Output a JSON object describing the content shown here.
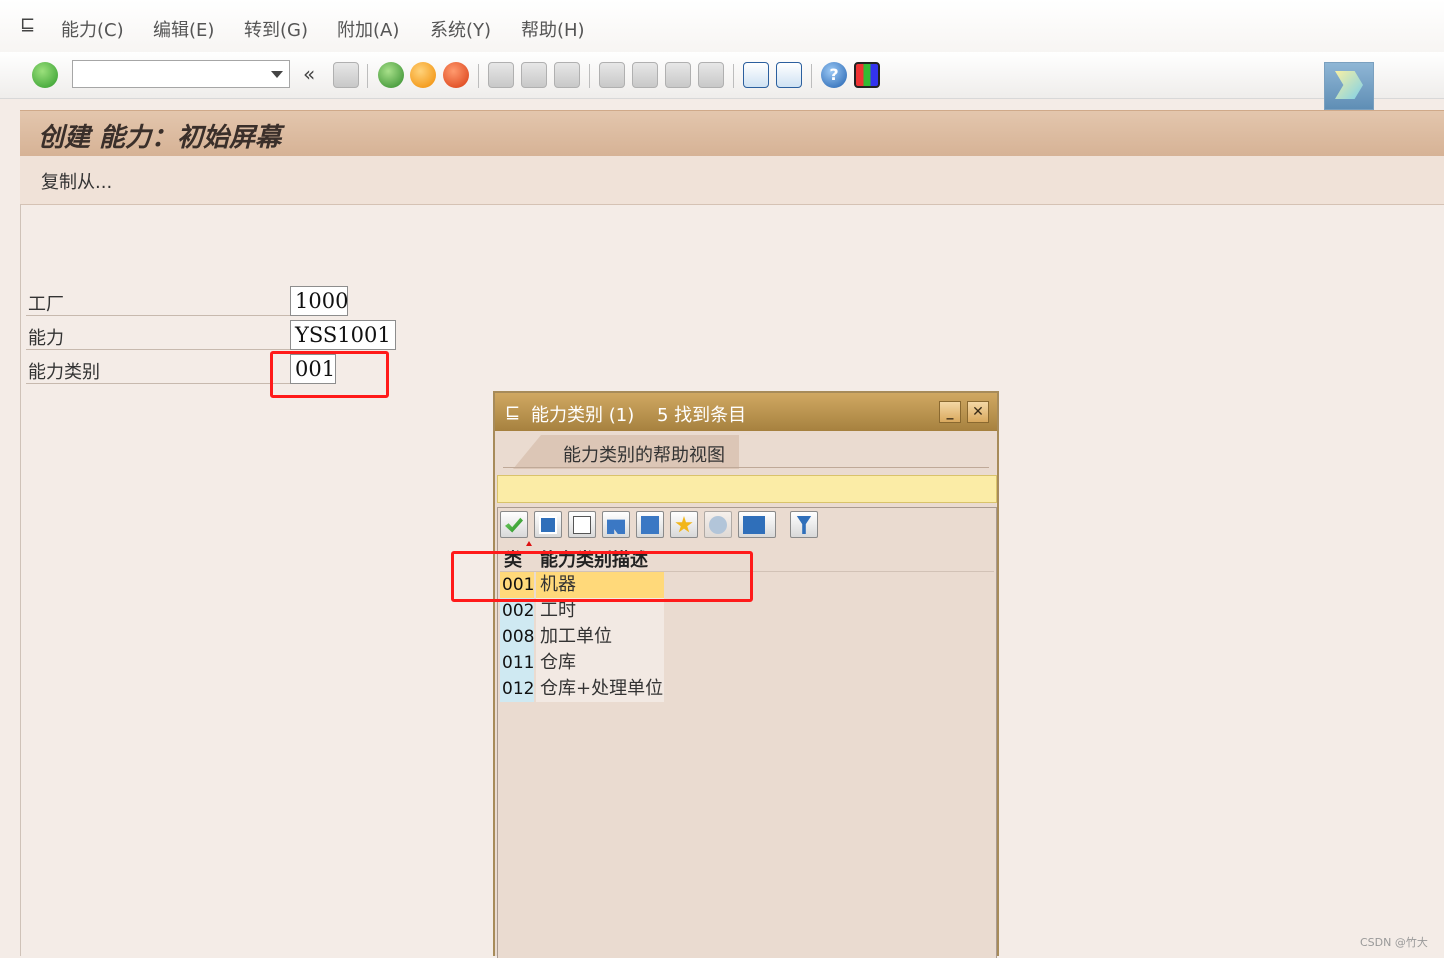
{
  "menubar": {
    "items": [
      {
        "label": "能力(C)"
      },
      {
        "label": "编辑(E)"
      },
      {
        "label": "转到(G)"
      },
      {
        "label": "附加(A)"
      },
      {
        "label": "系统(Y)"
      },
      {
        "label": "帮助(H)"
      }
    ]
  },
  "toolbar": {
    "command_field_value": "",
    "collapse_glyph": "«"
  },
  "header": {
    "title": "创建 能力：初始屏幕",
    "copy_from": "复制从..."
  },
  "form": {
    "plant_label": "工厂",
    "plant_value": "1000",
    "capacity_label": "能力",
    "capacity_value": "YSS1001",
    "category_label": "能力类别",
    "category_value": "001"
  },
  "popup": {
    "title": "能力类别 (1)",
    "count_text": "5 找到条目",
    "tab_label": "能力类别的帮助视图",
    "minimize_glyph": "_",
    "close_glyph": "✕",
    "columns": [
      "类",
      "能力类别描述"
    ],
    "rows": [
      {
        "code": "001",
        "desc": "机器"
      },
      {
        "code": "002",
        "desc": "工时"
      },
      {
        "code": "008",
        "desc": "加工单位"
      },
      {
        "code": "011",
        "desc": "仓库"
      },
      {
        "code": "012",
        "desc": "仓库+处理单位"
      }
    ],
    "selected_row": "001"
  },
  "watermark": "CSDN @竹大",
  "colors": {
    "background": "#f4ece7",
    "title_bar": "#d6b295",
    "popup_titlebar": "#a6813f",
    "selection": "#ffd97a",
    "highlight_box": "#ff1a1a"
  }
}
